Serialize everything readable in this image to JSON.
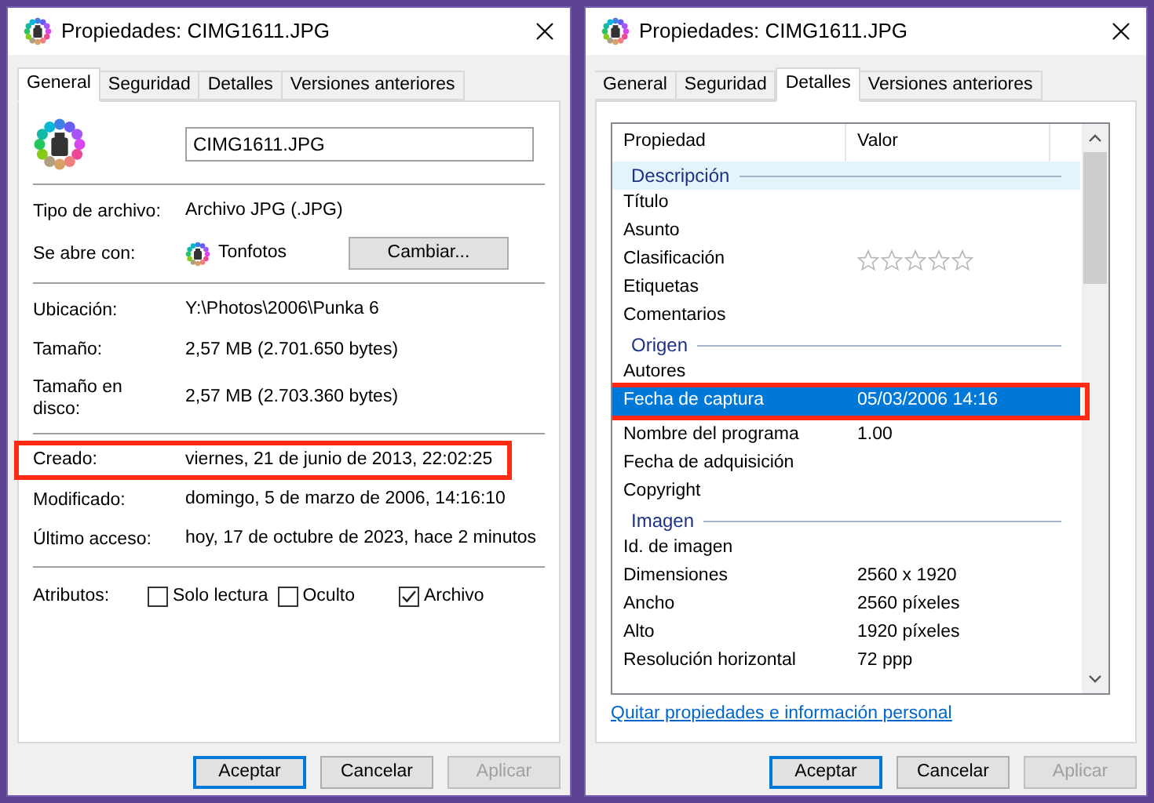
{
  "dialogs": [
    {
      "kind": "general",
      "title": "Propiedades: CIMG1611.JPG",
      "tabs": [
        {
          "label": "General",
          "selected": true
        },
        {
          "label": "Seguridad",
          "selected": false
        },
        {
          "label": "Detalles",
          "selected": false
        },
        {
          "label": "Versiones anteriores",
          "selected": false
        }
      ],
      "file_name": "CIMG1611.JPG",
      "groups": [
        [
          {
            "kind": "text",
            "label": "Tipo de archivo:",
            "value": "Archivo JPG (.JPG)",
            "highlighted": false
          },
          {
            "kind": "app",
            "label": "Se abre con:",
            "value": "Tonfotos",
            "button": "Cambiar...",
            "highlighted": false
          }
        ],
        [
          {
            "kind": "text",
            "label": "Ubicación:",
            "value": "Y:\\Photos\\2006\\Punka 6",
            "highlighted": false
          },
          {
            "kind": "text",
            "label": "Tamaño:",
            "value": "2,57 MB (2.701.650 bytes)",
            "highlighted": false
          },
          {
            "kind": "text",
            "label": "Tamaño en disco:",
            "value": "2,57 MB (2.703.360 bytes)",
            "highlighted": false
          }
        ],
        [
          {
            "kind": "text",
            "label": "Creado:",
            "value": "viernes, 21 de junio de 2013, 22:02:25",
            "highlighted": true
          },
          {
            "kind": "text",
            "label": "Modificado:",
            "value": "domingo, 5 de marzo de 2006, 14:16:10",
            "highlighted": false
          },
          {
            "kind": "text",
            "label": "Último acceso:",
            "value": "hoy, 17 de octubre de 2023, hace 2 minutos",
            "highlighted": false
          }
        ]
      ],
      "attributes": {
        "label": "Atributos:",
        "options": [
          {
            "label": "Solo lectura",
            "checked": false
          },
          {
            "label": "Oculto",
            "checked": false
          },
          {
            "label": "Archivo",
            "checked": true
          }
        ]
      },
      "buttons": [
        {
          "label": "Aceptar",
          "default": true,
          "disabled": false
        },
        {
          "label": "Cancelar",
          "default": false,
          "disabled": false
        },
        {
          "label": "Aplicar",
          "default": false,
          "disabled": true
        }
      ]
    },
    {
      "kind": "details",
      "title": "Propiedades: CIMG1611.JPG",
      "tabs": [
        {
          "label": "General",
          "selected": false
        },
        {
          "label": "Seguridad",
          "selected": false
        },
        {
          "label": "Detalles",
          "selected": true
        },
        {
          "label": "Versiones anteriores",
          "selected": false
        }
      ],
      "columns": [
        "Propiedad",
        "Valor"
      ],
      "rows": [
        {
          "kind": "group",
          "name": "Descripción",
          "hover": true
        },
        {
          "kind": "property",
          "name": "Título",
          "selected": false,
          "highlighted": false
        },
        {
          "kind": "property",
          "name": "Asunto",
          "selected": false,
          "highlighted": false
        },
        {
          "kind": "rating",
          "name": "Clasificación",
          "stars": 0,
          "selected": false,
          "highlighted": false
        },
        {
          "kind": "property",
          "name": "Etiquetas",
          "selected": false,
          "highlighted": false
        },
        {
          "kind": "property",
          "name": "Comentarios",
          "selected": false,
          "highlighted": false
        },
        {
          "kind": "group",
          "name": "Origen",
          "hover": false
        },
        {
          "kind": "property",
          "name": "Autores",
          "selected": false,
          "highlighted": false
        },
        {
          "kind": "property",
          "name": "Fecha de captura",
          "value": "05/03/2006 14:16",
          "selected": true,
          "highlighted": true
        },
        {
          "kind": "property",
          "name": "Nombre del programa",
          "value": "1.00",
          "selected": false,
          "highlighted": false
        },
        {
          "kind": "property",
          "name": "Fecha de adquisición",
          "selected": false,
          "highlighted": false
        },
        {
          "kind": "property",
          "name": "Copyright",
          "selected": false,
          "highlighted": false
        },
        {
          "kind": "group",
          "name": "Imagen",
          "hover": false
        },
        {
          "kind": "property",
          "name": "Id. de imagen",
          "selected": false,
          "highlighted": false
        },
        {
          "kind": "property",
          "name": "Dimensiones",
          "value": "2560 x 1920",
          "selected": false,
          "highlighted": false
        },
        {
          "kind": "property",
          "name": "Ancho",
          "value": "2560 píxeles",
          "selected": false,
          "highlighted": false
        },
        {
          "kind": "property",
          "name": "Alto",
          "value": "1920 píxeles",
          "selected": false,
          "highlighted": false
        },
        {
          "kind": "property",
          "name": "Resolución horizontal",
          "value": "72 ppp",
          "selected": false,
          "highlighted": false
        }
      ],
      "link": "Quitar propiedades e información personal",
      "buttons": [
        {
          "label": "Aceptar",
          "default": true,
          "disabled": false
        },
        {
          "label": "Cancelar",
          "default": false,
          "disabled": false
        },
        {
          "label": "Aplicar",
          "default": false,
          "disabled": true
        }
      ]
    }
  ]
}
